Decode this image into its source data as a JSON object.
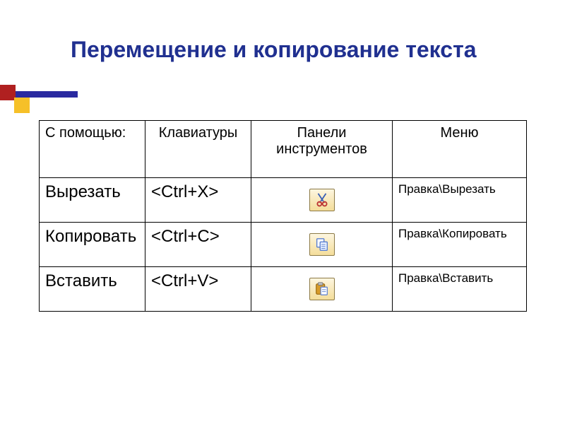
{
  "title": "Перемещение и копирование текста",
  "headers": {
    "col1": "С помощью:",
    "col2": "Клавиатуры",
    "col3": "Панели инструментов",
    "col4": "Меню"
  },
  "rows": [
    {
      "name": "Вырезать",
      "shortcut": "<Ctrl+X>",
      "icon": "cut",
      "menu": "Правка\\Вырезать"
    },
    {
      "name": "Копировать",
      "shortcut": "<Ctrl+C>",
      "icon": "copy",
      "menu": "Правка\\Копировать"
    },
    {
      "name": "Вставить",
      "shortcut": "<Ctrl+V>",
      "icon": "paste",
      "menu": "Правка\\Вставить"
    }
  ]
}
